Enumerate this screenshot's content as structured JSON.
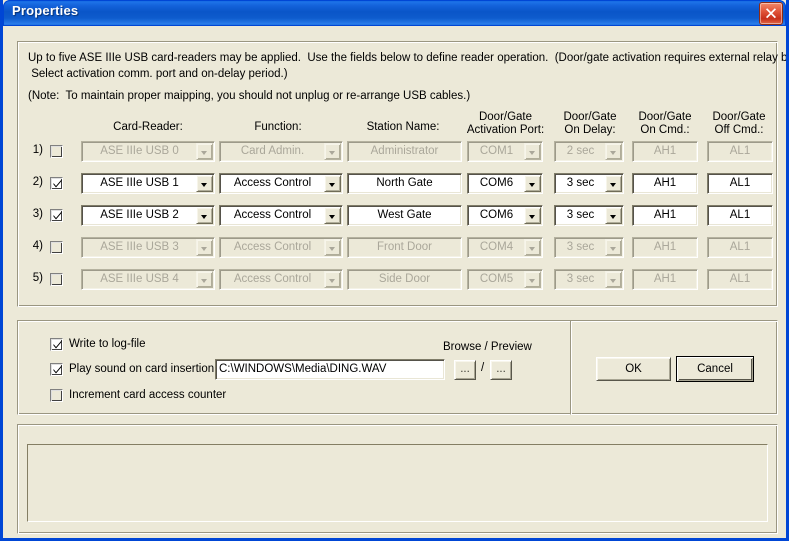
{
  "window": {
    "title": "Properties",
    "close_label": "Close",
    "close_icon": "close-icon"
  },
  "description": {
    "line1": "Up to five ASE IIIe USB card-readers may be applied.  Use the fields below to define reader operation.  (Door/gate activation requires external relay board(s).",
    "line2": " Select activation comm. port and on-delay period.)",
    "line3": "(Note:  To maintain proper maipping, you should not unplug or re-arrange USB cables.)"
  },
  "columns": {
    "card_reader": "Card-Reader:",
    "function": "Function:",
    "station_name": "Station Name:",
    "activation_port": "Door/Gate\nActivation Port:",
    "on_delay": "Door/Gate\nOn Delay:",
    "on_cmd": "Door/Gate\nOn Cmd.:",
    "off_cmd": "Door/Gate\nOff Cmd.:"
  },
  "rows": [
    {
      "num": "1)",
      "enabled": false,
      "card_reader": "ASE IIIe USB 0",
      "function": "Card Admin.",
      "station_name": "Administrator",
      "activation_port": "COM1",
      "on_delay": "2 sec",
      "on_cmd": "AH1",
      "off_cmd": "AL1"
    },
    {
      "num": "2)",
      "enabled": true,
      "card_reader": "ASE IIIe USB 1",
      "function": "Access Control",
      "station_name": "North Gate",
      "activation_port": "COM6",
      "on_delay": "3 sec",
      "on_cmd": "AH1",
      "off_cmd": "AL1"
    },
    {
      "num": "3)",
      "enabled": true,
      "card_reader": "ASE IIIe USB 2",
      "function": "Access Control",
      "station_name": "West Gate",
      "activation_port": "COM6",
      "on_delay": "3 sec",
      "on_cmd": "AH1",
      "off_cmd": "AL1"
    },
    {
      "num": "4)",
      "enabled": false,
      "card_reader": "ASE IIIe USB 3",
      "function": "Access Control",
      "station_name": "Front Door",
      "activation_port": "COM4",
      "on_delay": "3 sec",
      "on_cmd": "AH1",
      "off_cmd": "AL1"
    },
    {
      "num": "5)",
      "enabled": false,
      "card_reader": "ASE IIIe USB 4",
      "function": "Access Control",
      "station_name": "Side Door",
      "activation_port": "COM5",
      "on_delay": "3 sec",
      "on_cmd": "AH1",
      "off_cmd": "AL1"
    }
  ],
  "options": {
    "write_log": {
      "label": "Write to log-file",
      "checked": true
    },
    "play_sound": {
      "label": "Play sound on card insertion:",
      "checked": true
    },
    "increment_counter": {
      "label": "Increment card access counter",
      "checked": false
    },
    "sound_path": "C:\\WINDOWS\\Media\\DING.WAV",
    "browse_preview_label": "Browse / Preview",
    "browse_button": "...",
    "separator": "/",
    "preview_button": "..."
  },
  "actions": {
    "ok": "OK",
    "cancel": "Cancel"
  }
}
